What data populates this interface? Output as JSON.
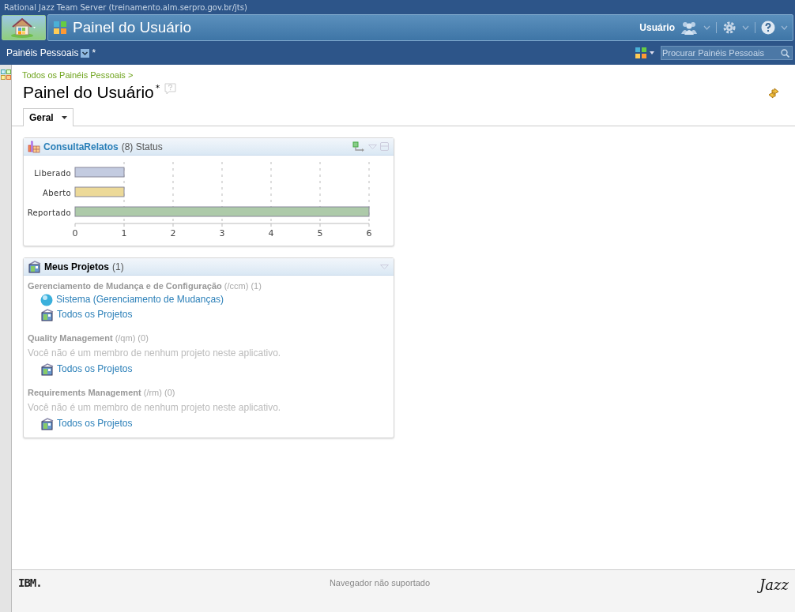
{
  "title_bar": {
    "title": "Rational Jazz Team Server (treinamento.alm.serpro.gov.br/jts)"
  },
  "banner": {
    "title": "Painel do Usuário",
    "user": "Usuário"
  },
  "sub_bar": {
    "menu_label": "Painéis Pessoais",
    "modified_mark": "*",
    "search": {
      "placeholder": "Procurar Painéis Pessoais"
    }
  },
  "breadcrumb": "Todos os Painéis Pessoais >",
  "page": {
    "title": "Painel do Usuário",
    "modified_mark": "*"
  },
  "tabs": [
    {
      "label": "Geral",
      "selected": true
    }
  ],
  "widgets": [
    {
      "kind": "chart",
      "title": "ConsultaRelatos",
      "count": "(8)",
      "subtitle": "Status",
      "chart_data": {
        "type": "bar",
        "orientation": "horizontal",
        "grid": true,
        "categories": [
          "Liberado",
          "Aberto",
          "Reportado"
        ],
        "xticks": [
          0,
          1,
          2,
          3,
          4,
          5,
          6
        ],
        "xlim": [
          0,
          6
        ],
        "series": [
          {
            "color": "#c3cbe0",
            "values": [
              1,
              null,
              null
            ]
          },
          {
            "color": "#ecd998",
            "values": [
              null,
              1,
              null
            ]
          },
          {
            "color": "#adcaa9",
            "values": [
              null,
              null,
              6
            ]
          }
        ]
      }
    },
    {
      "kind": "projects",
      "title": "Meus Projetos",
      "count": "(1)",
      "sections": [
        {
          "name": "Gerenciamento de Mudança e de Configuração",
          "path": "(/ccm)",
          "count": "(1)",
          "items": [
            {
              "kind": "project",
              "label": "Sistema (Gerenciamento de Mudanças)"
            },
            {
              "kind": "all",
              "label": "Todos os Projetos"
            }
          ]
        },
        {
          "name": "Quality Management",
          "path": "(/qm)",
          "count": "(0)",
          "message": "Você não é um membro de nenhum projeto neste aplicativo.",
          "items": [
            {
              "kind": "all",
              "label": "Todos os Projetos"
            }
          ]
        },
        {
          "name": "Requirements Management",
          "path": "(/rm)",
          "count": "(0)",
          "message": "Você não é um membro de nenhum projeto neste aplicativo.",
          "items": [
            {
              "kind": "all",
              "label": "Todos os Projetos"
            }
          ]
        }
      ]
    }
  ],
  "footer": {
    "logo": "IBM.",
    "status": "Navegador não suportado",
    "brand": "Jazz"
  }
}
